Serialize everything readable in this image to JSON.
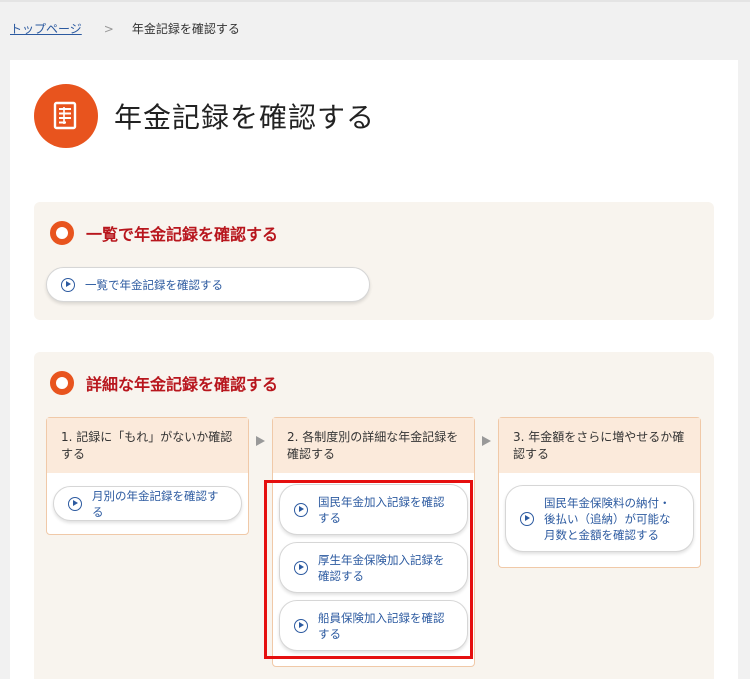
{
  "breadcrumb": {
    "home": "トップページ",
    "separator": ">",
    "current": "年金記録を確認する"
  },
  "page": {
    "title": "年金記録を確認する",
    "icon": "document-list-icon"
  },
  "section1": {
    "title": "一覧で年金記録を確認する",
    "button": "一覧で年金記録を確認する"
  },
  "section2": {
    "title": "詳細な年金記録を確認する",
    "columns": [
      {
        "heading": "1. 記録に「もれ」がないか確認する",
        "buttons": [
          "月別の年金記録を確認する"
        ]
      },
      {
        "heading": "2. 各制度別の詳細な年金記録を確認する",
        "buttons": [
          "国民年金加入記録を確認する",
          "厚生年金保険加入記録を確認する",
          "船員保険加入記録を確認する"
        ]
      },
      {
        "heading": "3. 年金額をさらに増やせるか確認する",
        "buttons": [
          "国民年金保険料の納付・後払い（追納）が可能な月数と金額を確認する"
        ]
      }
    ]
  },
  "colors": {
    "accent": "#e8541e",
    "section_title": "#b8161d",
    "link": "#2c5aa0",
    "highlight": "#e50f0f"
  }
}
